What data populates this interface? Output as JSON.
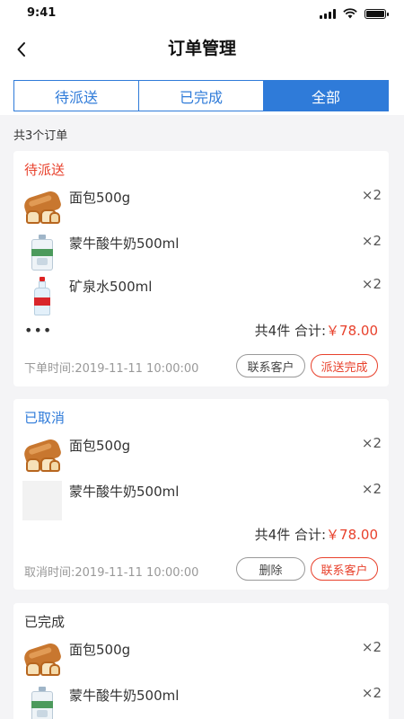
{
  "status_bar": {
    "time": "9:41"
  },
  "header": {
    "title": "订单管理"
  },
  "tabs": [
    {
      "label": "待派送",
      "active": false
    },
    {
      "label": "已完成",
      "active": false
    },
    {
      "label": "全部",
      "active": true
    }
  ],
  "order_count": "共3个订单",
  "colors": {
    "accent": "#2f7bd9",
    "price_red": "#e8412c",
    "background": "#f4f4f6"
  },
  "orders": [
    {
      "status": "待派送",
      "items": [
        {
          "name": "面包500g",
          "qty": "×2",
          "image": "bread-image"
        },
        {
          "name": "蒙牛酸牛奶500ml",
          "qty": "×2",
          "image": "milk-bottle-image"
        },
        {
          "name": "矿泉水500ml",
          "qty": "×2",
          "image": "water-bottle-image"
        }
      ],
      "more": "•••",
      "summary_prefix": "共4件 合计:",
      "total": "￥78.00",
      "time_label": "下单时间:2019-11-11 10:00:00",
      "buttons": [
        "联系客户",
        "派送完成"
      ]
    },
    {
      "status": "已取消",
      "items": [
        {
          "name": "面包500g",
          "qty": "×2",
          "image": "bread-image"
        },
        {
          "name": "蒙牛酸牛奶500ml",
          "qty": "×2",
          "image": "image-placeholder"
        }
      ],
      "summary_prefix": "共4件 合计:",
      "total": "￥78.00",
      "time_label": "取消时间:2019-11-11 10:00:00",
      "buttons": [
        "删除",
        "联系客户"
      ]
    },
    {
      "status": "已完成",
      "items": [
        {
          "name": "面包500g",
          "qty": "×2",
          "image": "bread-image"
        },
        {
          "name": "蒙牛酸牛奶500ml",
          "qty": "×2",
          "image": "milk-bottle-image"
        }
      ]
    }
  ]
}
